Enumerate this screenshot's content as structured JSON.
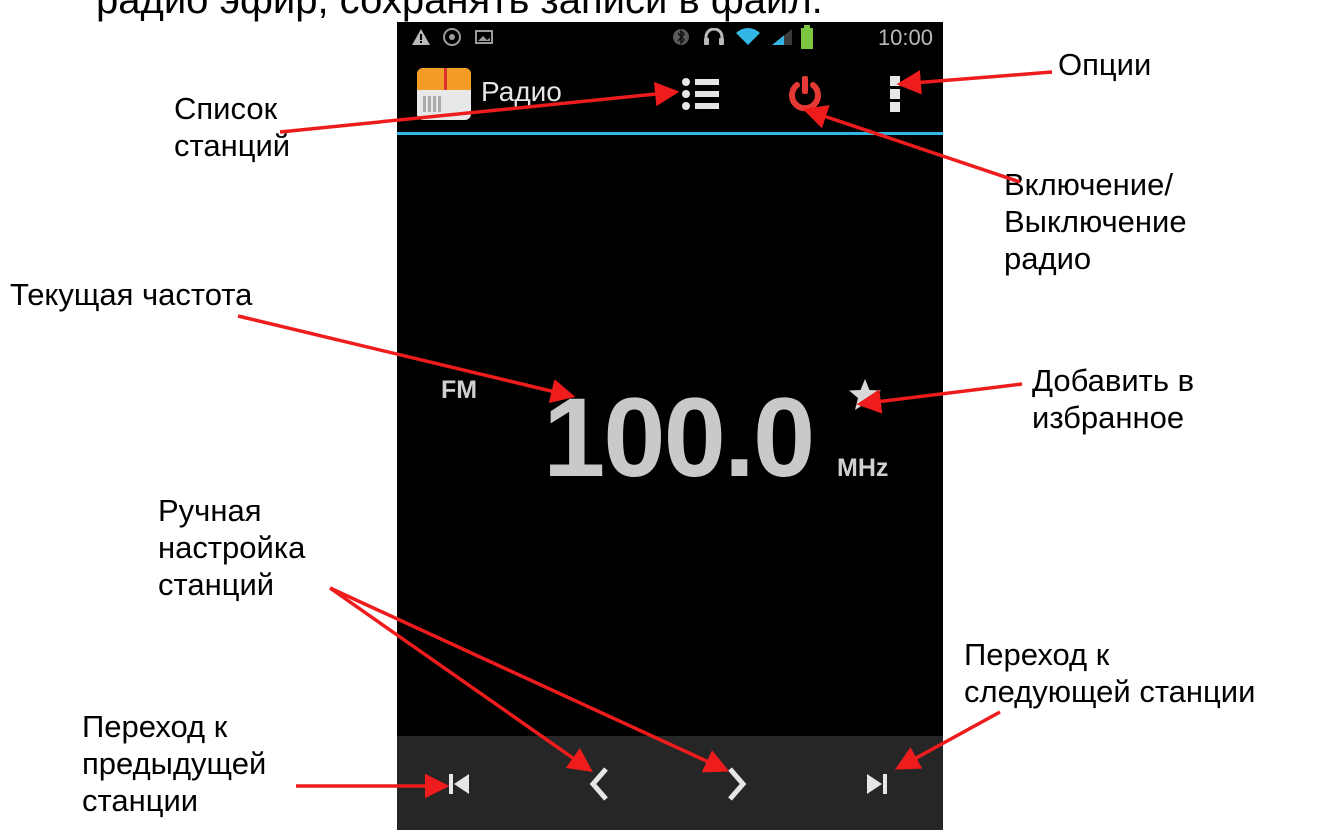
{
  "heading_partial": "радио эфир, сохранять записи в файл.",
  "status_bar": {
    "time": "10:00",
    "icons": [
      "warning-icon",
      "notification-icon",
      "image-icon",
      "bluetooth-icon",
      "headphones-icon",
      "wifi-icon",
      "signal-icon",
      "battery-icon"
    ],
    "battery_color": "#7cc53f"
  },
  "action_bar": {
    "app_title": "Радио",
    "station_list_icon": "list-icon",
    "power_icon": "power-icon",
    "power_color": "#e53935",
    "menu_icon": "overflow-menu-icon",
    "divider_color": "#33b5e5"
  },
  "tuner": {
    "band": "FM",
    "frequency": "100.0",
    "unit": "MHz",
    "favorite_icon": "star-icon"
  },
  "bottom_bar": {
    "buttons": [
      "skip-previous-icon",
      "chevron-left-icon",
      "chevron-right-icon",
      "skip-next-icon"
    ]
  },
  "annotations": {
    "station_list": [
      "Список",
      "станций"
    ],
    "options": [
      "Опции"
    ],
    "power": [
      "Включение/",
      "Выключение",
      "радио"
    ],
    "current_frequency": [
      "Текущая частота"
    ],
    "add_favorite": [
      "Добавить в",
      "избранное"
    ],
    "manual_tuning": [
      "Ручная",
      "настройка",
      "станций"
    ],
    "next_station": [
      "Переход к",
      "следующей станции"
    ],
    "prev_station": [
      "Переход к",
      "предыдущей",
      "станции"
    ]
  },
  "arrow_color": "#ee1c1c"
}
